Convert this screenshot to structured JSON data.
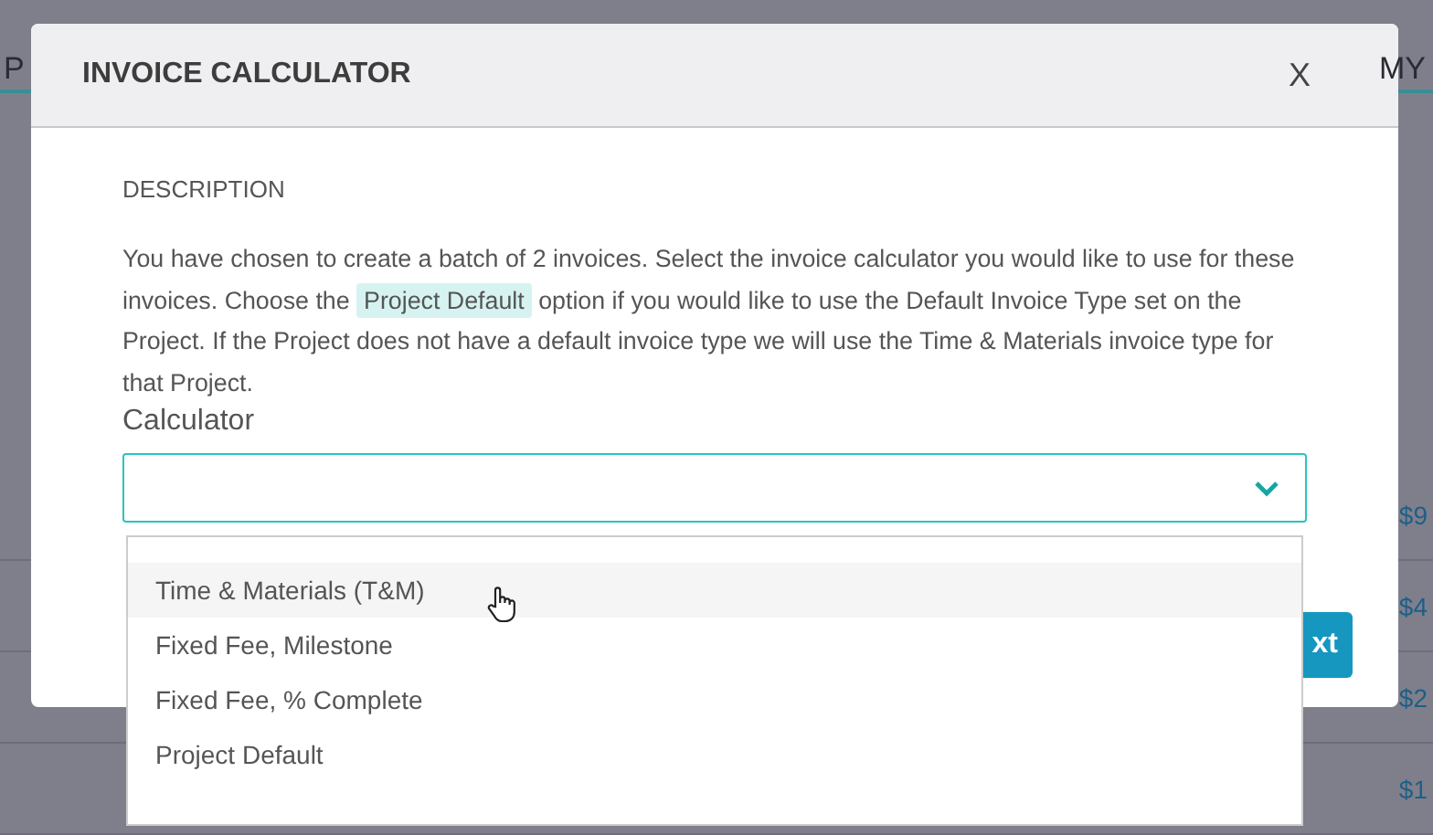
{
  "background_table": {
    "header_left": "P",
    "header_right": "MY",
    "amounts": [
      "$9",
      "$4",
      "$2",
      "$1"
    ]
  },
  "dialog": {
    "title": "INVOICE CALCULATOR",
    "close": "X",
    "section": "DESCRIPTION",
    "description_before": "You have chosen to create a batch of 2 invoices. Select the invoice calculator you would like to use for these invoices. Choose the ",
    "description_highlight": "Project Default",
    "description_after": " option if you would like to use the Default Invoice Type set on the Project. If the Project does not have a default invoice type we will use the Time & Materials invoice type for that Project.",
    "field_label": "Calculator",
    "next_button": "xt"
  },
  "dropdown": {
    "expanded": true,
    "options": [
      {
        "label": "Time & Materials (T&M)",
        "hovered": true
      },
      {
        "label": "Fixed Fee, Milestone",
        "hovered": false
      },
      {
        "label": "Fixed Fee, % Complete",
        "hovered": false
      },
      {
        "label": "Project Default",
        "hovered": false
      }
    ]
  }
}
